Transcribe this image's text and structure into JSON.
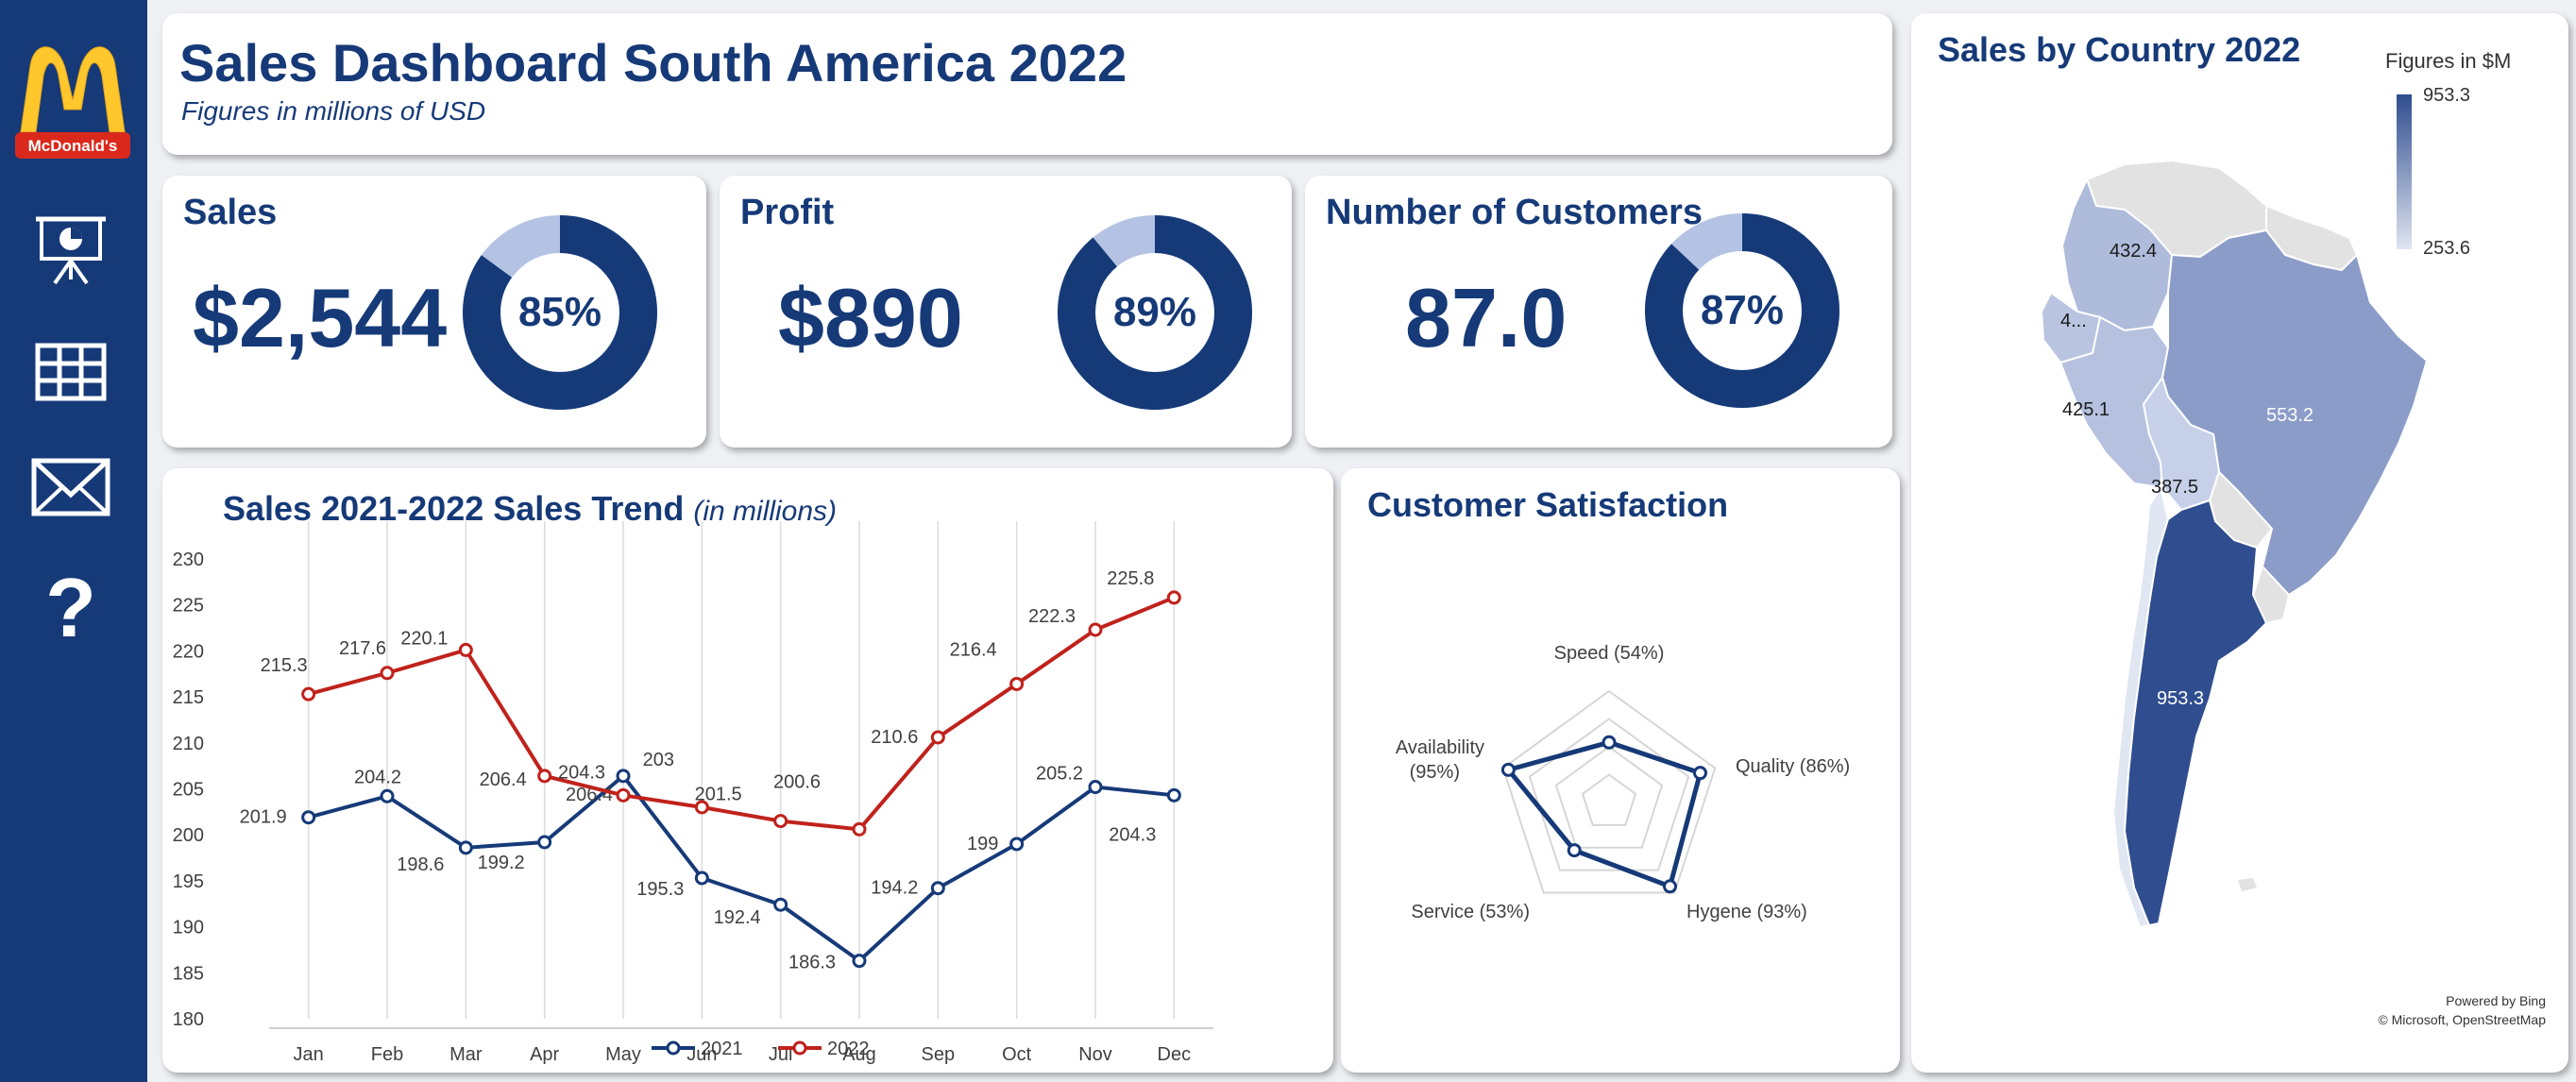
{
  "brand": {
    "logo_text": "McDonald's",
    "logo_color": "#ffc72c",
    "logo_bg": "#da291c"
  },
  "sidebar": {
    "items": [
      {
        "name": "presentation-icon"
      },
      {
        "name": "table-icon"
      },
      {
        "name": "mail-icon"
      },
      {
        "name": "help-icon",
        "glyph": "?"
      }
    ]
  },
  "header": {
    "title": "Sales Dashboard South America 2022",
    "subtitle": "Figures in millions of USD"
  },
  "kpis": [
    {
      "label": "Sales",
      "value": "$2,544",
      "percent_label": "85%",
      "percent": 85
    },
    {
      "label": "Profit",
      "value": "$890",
      "percent_label": "89%",
      "percent": 89
    },
    {
      "label": "Number of Customers",
      "value": "87.0",
      "percent_label": "87%",
      "percent": 87
    }
  ],
  "colors": {
    "navy": "#163a78",
    "red": "#c0221c",
    "donut_rest": "#b4c3e3"
  },
  "trend": {
    "title": "Sales 2021-2022 Sales Trend",
    "unit": "(in millions)",
    "chart_data": {
      "type": "line",
      "categories": [
        "Jan",
        "Feb",
        "Mar",
        "Apr",
        "May",
        "Jun",
        "Jul",
        "Aug",
        "Sep",
        "Oct",
        "Nov",
        "Dec"
      ],
      "ylim": [
        180,
        230
      ],
      "yticks": [
        180,
        185,
        190,
        195,
        200,
        205,
        210,
        215,
        220,
        225,
        230
      ],
      "legend": "bottom",
      "series": [
        {
          "name": "2021",
          "color": "#163a78",
          "values": [
            201.9,
            204.2,
            198.6,
            199.2,
            206.4,
            195.3,
            192.4,
            186.3,
            194.2,
            199,
            205.2,
            204.3
          ],
          "labels": [
            "201.9",
            "204.2",
            "198.6",
            "199.2",
            "206.4",
            "195.3",
            "192.4",
            "186.3",
            "194.2",
            "199",
            "205.2",
            "204.3"
          ]
        },
        {
          "name": "2022",
          "color": "#c0221c",
          "values": [
            215.3,
            217.6,
            220.1,
            206.4,
            204.3,
            203,
            201.5,
            200.6,
            210.6,
            216.4,
            222.3,
            225.8
          ],
          "labels": [
            "215.3",
            "217.6",
            "220.1",
            "206.4",
            "204.3",
            "203",
            "201.5",
            "200.6",
            "210.6",
            "216.4",
            "222.3",
            "225.8"
          ]
        }
      ]
    }
  },
  "satisfaction": {
    "title": "Customer Satisfaction",
    "chart_data": {
      "type": "radar",
      "max": 100,
      "axes": [
        {
          "label": "Speed (54%)",
          "value": 54
        },
        {
          "label": "Quality (86%)",
          "value": 86
        },
        {
          "label": "Hygene (93%)",
          "value": 93
        },
        {
          "label": "Service (53%)",
          "value": 53
        },
        {
          "label_line1": "Availability",
          "label_line2": "(95%)",
          "value": 95
        }
      ]
    }
  },
  "map": {
    "title": "Sales by Country 2022",
    "legend_title": "Figures in $M",
    "legend_max": "953.3",
    "legend_min": "253.6",
    "countries": [
      {
        "label": "432.4",
        "value": 432.4
      },
      {
        "label": "4...",
        "value": 400
      },
      {
        "label": "425.1",
        "value": 425.1
      },
      {
        "label": "553.2",
        "value": 553.2
      },
      {
        "label": "387.5",
        "value": 387.5
      },
      {
        "label": "953.3",
        "value": 953.3
      }
    ],
    "credit_line1": "Powered by Bing",
    "credit_line2": "© Microsoft, OpenStreetMap"
  }
}
